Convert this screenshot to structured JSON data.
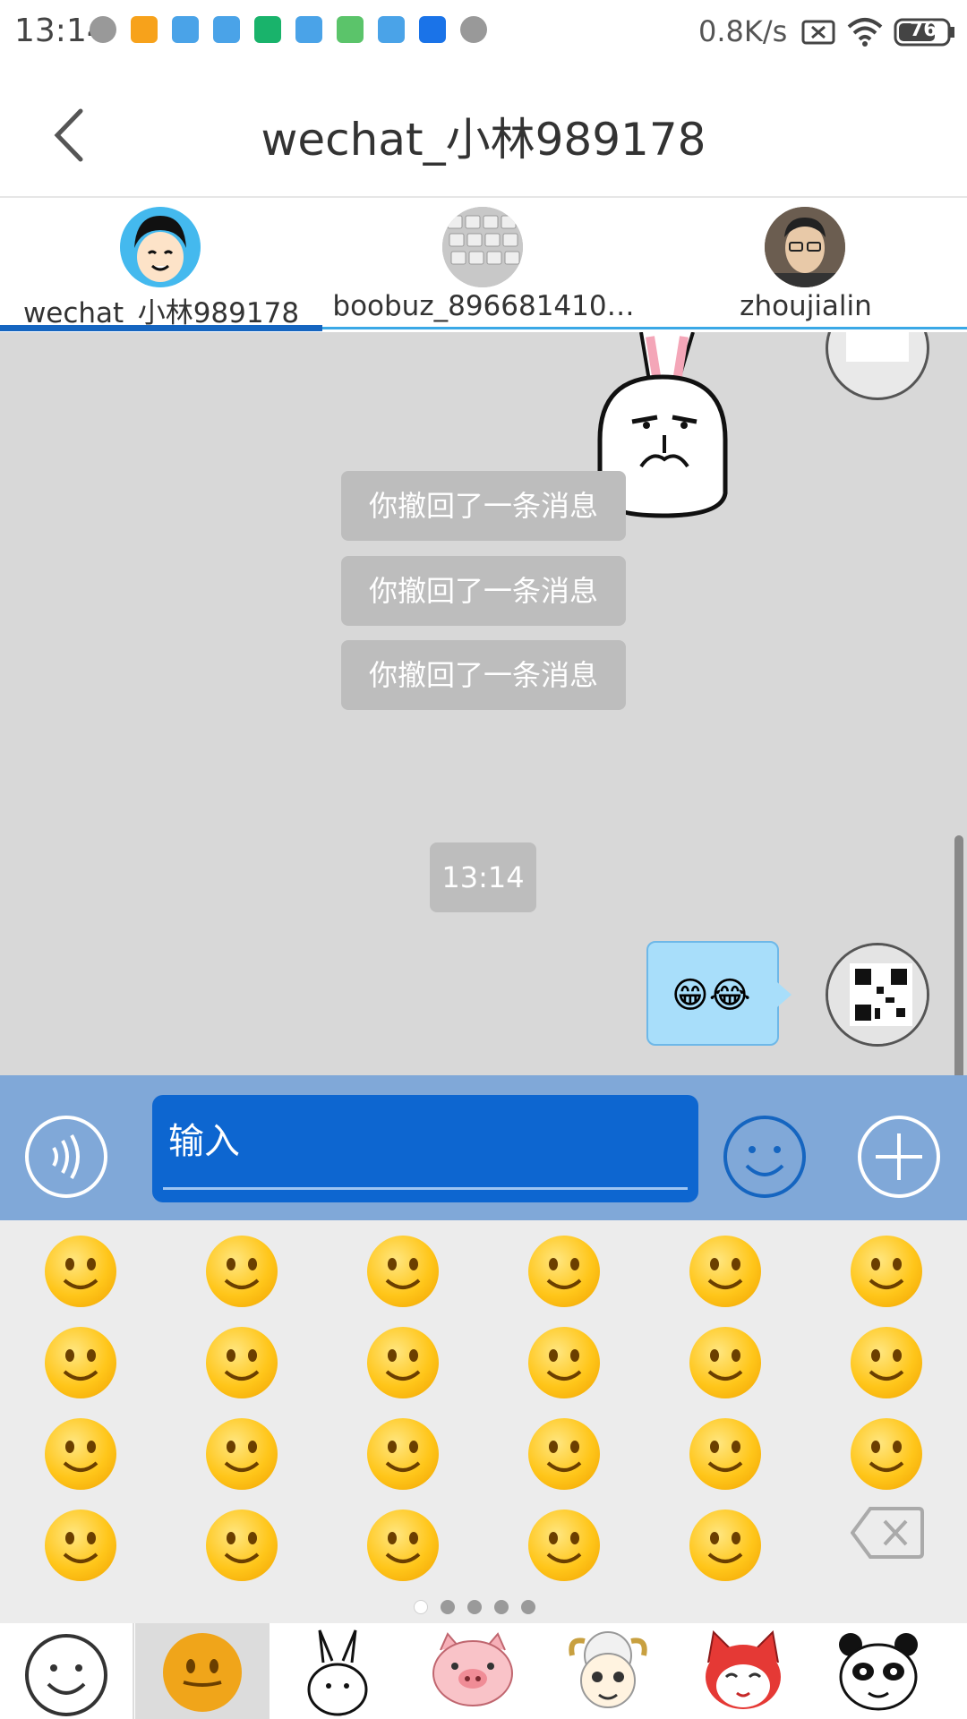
{
  "status_bar": {
    "time": "13:14",
    "net_speed": "0.8K/s",
    "battery": "76"
  },
  "header": {
    "back_icon": "chevron-left-icon",
    "title": "wechat_小林989178"
  },
  "contacts": [
    {
      "name": "wechat_小林989178",
      "active": true
    },
    {
      "name": "boobuz_896681410…",
      "active": false
    },
    {
      "name": "zhoujialin",
      "active": false
    }
  ],
  "chat": {
    "system_messages": [
      "你撤回了一条消息",
      "你撤回了一条消息",
      "你撤回了一条消息"
    ],
    "timestamp": "13:14",
    "last_message_emojis": "😁😂"
  },
  "input_bar": {
    "voice_icon": "voice-icon",
    "placeholder": "输入",
    "emoji_icon": "smiley-icon",
    "plus_icon": "plus-icon"
  },
  "emoji_panel": {
    "page_count": 5,
    "current_page": 1,
    "delete_icon": "backspace-icon"
  },
  "sticker_tabs": [
    "smiley-outline",
    "emoji-face",
    "rabbit",
    "pig",
    "sheep",
    "fox-cat",
    "panda"
  ],
  "colors": {
    "accent": "#1565c0",
    "input_bar": "#80a8d8",
    "input_field": "#0d66d0",
    "chat_bg": "#d8d8d8",
    "bubble": "#a8defa"
  }
}
